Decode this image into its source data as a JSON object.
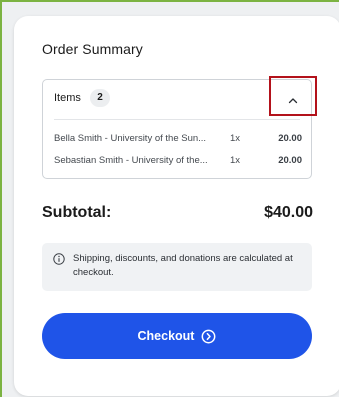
{
  "order_summary": {
    "title": "Order Summary",
    "items": {
      "label": "Items",
      "count": "2",
      "toggle_icon": "chevron-up-icon",
      "rows": [
        {
          "name": "Bella Smith - University of the Sun...",
          "qty": "1x",
          "price": "20.00"
        },
        {
          "name": "Sebastian Smith - University of the...",
          "qty": "1x",
          "price": "20.00"
        }
      ]
    },
    "subtotal_label": "Subtotal:",
    "subtotal_value": "$40.00",
    "note": {
      "icon": "info-icon",
      "text": "Shipping, discounts, and donations are calculated at checkout."
    },
    "checkout": {
      "label": "Checkout",
      "icon": "chevron-right-circle-icon"
    }
  },
  "colors": {
    "accent": "#1f54e8",
    "highlight": "#b3121b",
    "frame": "#7cb342"
  }
}
